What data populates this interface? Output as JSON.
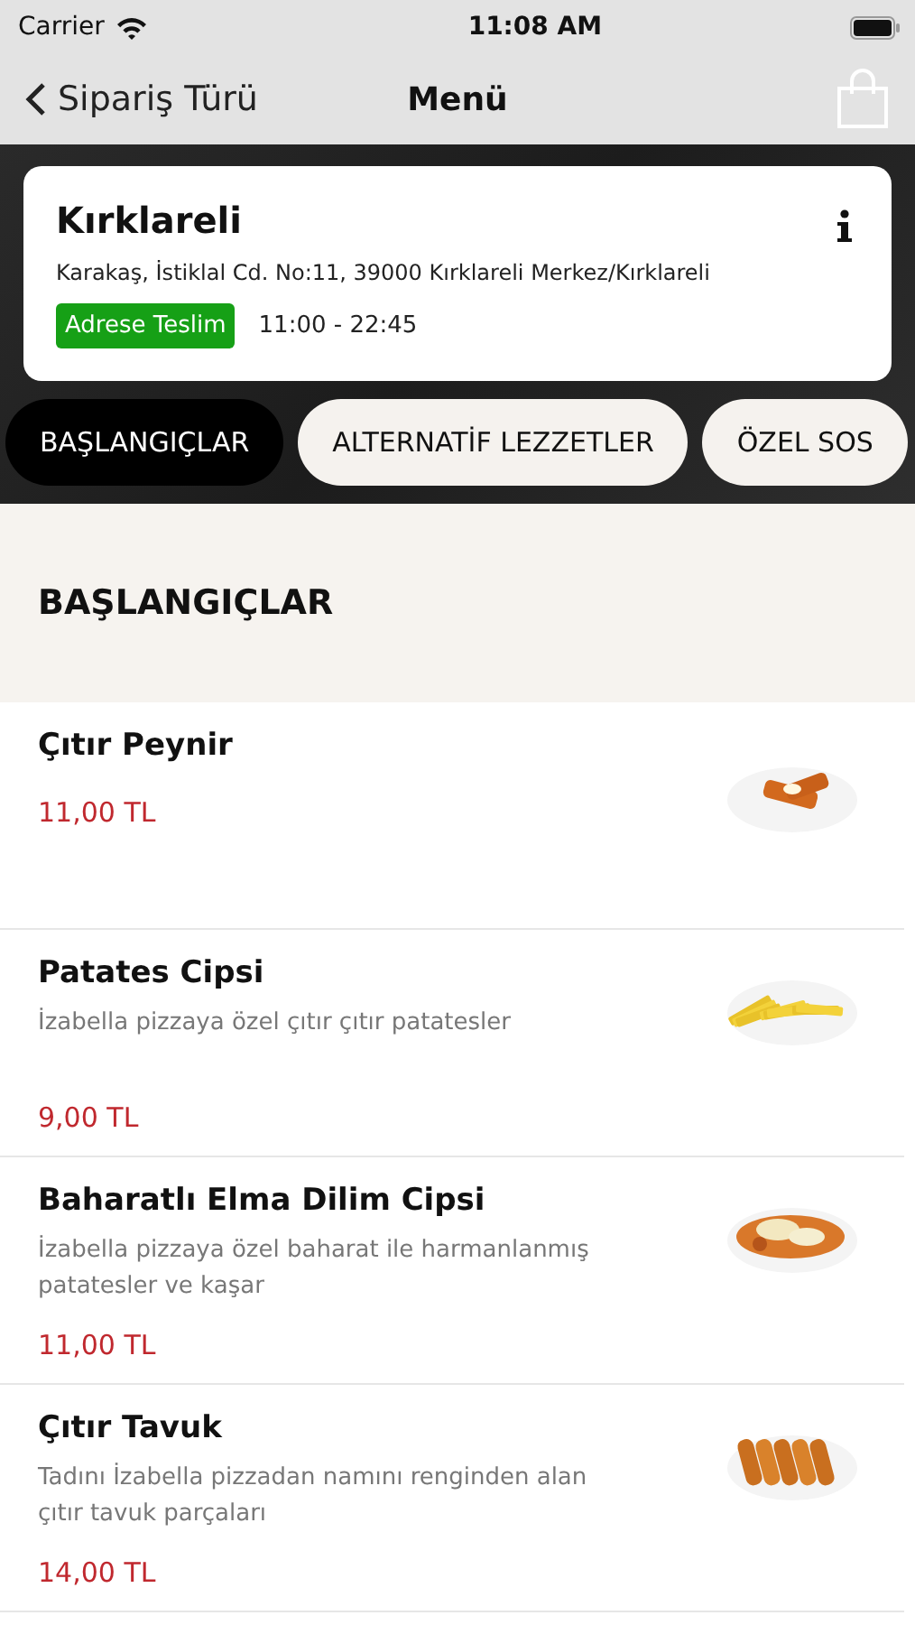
{
  "status_bar": {
    "carrier": "Carrier",
    "time": "11:08 AM"
  },
  "nav": {
    "back_label": "Sipariş Türü",
    "title": "Menü"
  },
  "store": {
    "name": "Kırklareli",
    "address": "Karakaş, İstiklal Cd. No:11, 39000 Kırklareli Merkez/Kırklareli",
    "delivery_badge": "Adrese Teslim",
    "hours": "11:00 - 22:45"
  },
  "categories": [
    {
      "label": "BAŞLANGIÇLAR",
      "selected": true
    },
    {
      "label": "ALTERNATİF LEZZETLER",
      "selected": false
    },
    {
      "label": "ÖZEL SOS",
      "selected": false
    }
  ],
  "section_title": "BAŞLANGIÇLAR",
  "items": [
    {
      "name": "Çıtır Peynir",
      "price": "11,00 TL"
    },
    {
      "name": "Patates Cipsi",
      "description": "İzabella pizzaya özel çıtır çıtır patatesler",
      "price": "9,00 TL"
    },
    {
      "name": "Baharatlı Elma Dilim Cipsi",
      "description": "İzabella pizzaya özel baharat ile harmanlanmış patatesler ve kaşar",
      "price": "11,00 TL"
    },
    {
      "name": "Çıtır Tavuk",
      "description": "Tadını İzabella pizzadan namını renginden alan çıtır tavuk parçaları",
      "price": "14,00 TL"
    }
  ]
}
